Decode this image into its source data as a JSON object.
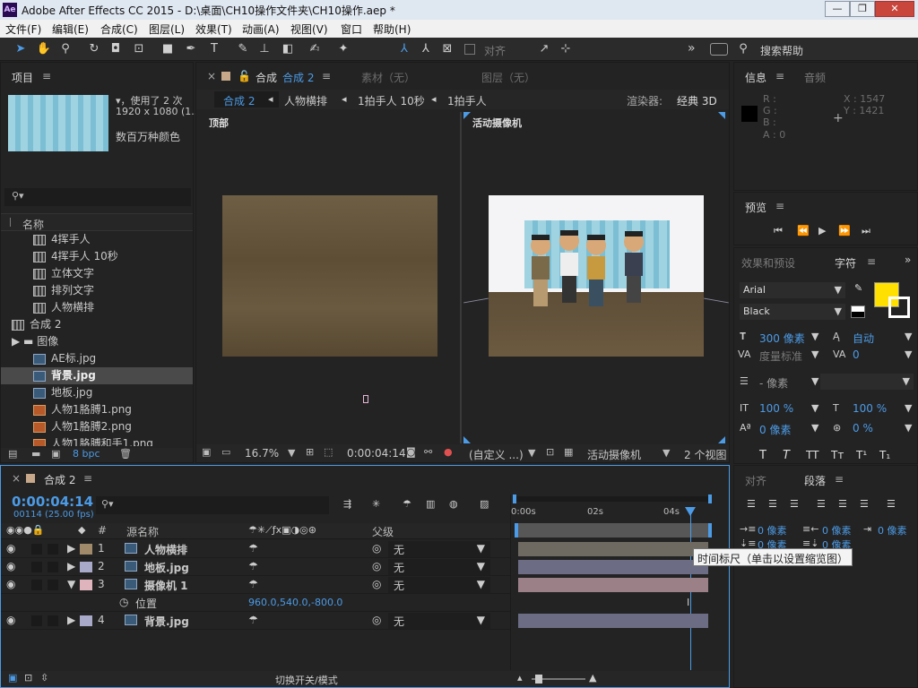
{
  "window": {
    "title": "Adobe After Effects CC 2015 - D:\\桌面\\CH10操作文件夹\\CH10操作.aep *",
    "logo": "Ae",
    "min": "—",
    "max": "❐",
    "close": "✕"
  },
  "menu": [
    "文件(F)",
    "编辑(E)",
    "合成(C)",
    "图层(L)",
    "效果(T)",
    "动画(A)",
    "视图(V)",
    "窗口",
    "帮助(H)"
  ],
  "toolbar": {
    "align_label": "对齐",
    "search_label": "搜索帮助",
    "expand": "»"
  },
  "project": {
    "tab": "项目",
    "menu": "≡",
    "used_text": "▾，使用了 2 次",
    "size_text": "1920 x 1080 (1...",
    "color_text": "数百万种颜色",
    "search_placeholder": "",
    "col_name": "名称",
    "items": [
      {
        "name": "4挥手人",
        "type": "comp",
        "indent": 1
      },
      {
        "name": "4挥手人 10秒",
        "type": "comp",
        "indent": 1
      },
      {
        "name": "立体文字",
        "type": "comp",
        "indent": 1
      },
      {
        "name": "排列文字",
        "type": "comp",
        "indent": 1
      },
      {
        "name": "人物横排",
        "type": "comp",
        "indent": 1
      },
      {
        "name": "合成 2",
        "type": "comp",
        "indent": 0
      },
      {
        "name": "图像",
        "type": "folder",
        "indent": 0
      },
      {
        "name": "AE标.jpg",
        "type": "img",
        "indent": 1
      },
      {
        "name": "背景.jpg",
        "type": "img",
        "indent": 1,
        "selected": true
      },
      {
        "name": "地板.jpg",
        "type": "img",
        "indent": 1
      },
      {
        "name": "人物1胳膊1.png",
        "type": "png",
        "indent": 1
      },
      {
        "name": "人物1胳膊2.png",
        "type": "png",
        "indent": 1
      },
      {
        "name": "人物1胳膊和手1.png",
        "type": "png",
        "indent": 1
      }
    ],
    "bpc": "8 bpc"
  },
  "comp_viewer": {
    "tab_close": "×",
    "tab_label": "合成",
    "tab_active": "合成 2",
    "tab_menu": "≡",
    "footage_tab": "素材（无）",
    "layer_tab": "图层（无）",
    "breadcrumbs": [
      "合成 2",
      "人物横排",
      "1拍手人 10秒",
      "1拍手人"
    ],
    "renderer_label": "渲染器:",
    "renderer_value": "经典 3D",
    "left_view_label": "顶部",
    "right_view_label": "活动摄像机",
    "zoom": "16.7%",
    "time": "0:00:04:14",
    "resolution": "(自定义 ...)",
    "camera": "活动摄像机",
    "views": "2 个视图"
  },
  "info": {
    "tab": "信息",
    "audio_tab": "音频",
    "r": "R :",
    "g": "G :",
    "b": "B :",
    "a": "A : 0",
    "x": "X : 1547",
    "y": "Y : 1421"
  },
  "preview": {
    "tab": "预览"
  },
  "effects_tab": "效果和预设",
  "character": {
    "tab": "字符",
    "font": "Arial",
    "style": "Black",
    "size": "300 像素",
    "leading": "自动",
    "kerning": "度量标准",
    "tracking": "0",
    "stroke": "- 像素",
    "vscale": "100 %",
    "hscale": "100 %",
    "baseline": "0 像素",
    "tsume": "0 %",
    "fill_color": "#FFE000"
  },
  "align_tab": "对齐",
  "paragraph": {
    "tab": "段落",
    "indent1": "0 像素",
    "indent2": "0 像素",
    "indent3": "0 像素",
    "space1": "0 像素",
    "space2": "0 像素"
  },
  "timeline": {
    "tab_close": "×",
    "tab": "合成 2",
    "tab_menu": "≡",
    "time": "0:00:04:14",
    "frames": "00114 (25.00 fps)",
    "col_num": "#",
    "col_source": "源名称",
    "col_parent": "父级",
    "layers": [
      {
        "num": "1",
        "name": "人物横排",
        "color": "#a08a6a",
        "parent": "无",
        "bar": "#6e6a62"
      },
      {
        "num": "2",
        "name": "地板.jpg",
        "color": "#a8a8c8",
        "parent": "无",
        "bar": "#6c6c84"
      },
      {
        "num": "3",
        "name": "摄像机 1",
        "color": "#e0b4bc",
        "parent": "无",
        "bar": "#9c8088"
      },
      {
        "num": "4",
        "name": "背景.jpg",
        "color": "#a8a8c8",
        "parent": "无",
        "bar": "#6c6c84"
      }
    ],
    "position_label": "位置",
    "position_value": "960.0,540.0,-800.0",
    "ruler": [
      "0:00s",
      "02s",
      "04s"
    ],
    "tooltip": "时间标尺（单击以设置缩览图）",
    "footer": "切换开关/模式"
  }
}
